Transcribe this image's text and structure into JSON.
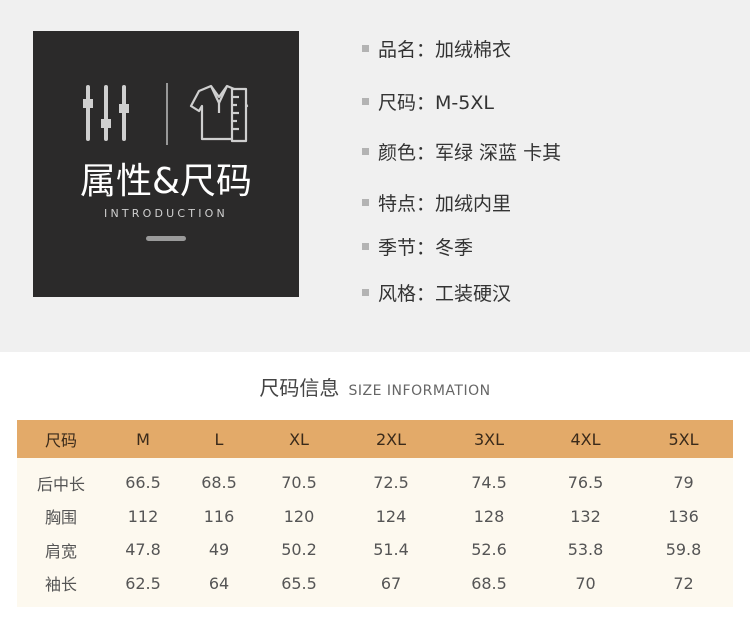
{
  "badge": {
    "title": "属性&尺码",
    "subtitle": "INTRODUCTION",
    "sliders_icon": "sliders-icon",
    "shirt_icon": "shirt-ruler-icon"
  },
  "attributes": [
    {
      "text": "品名：加绒棉衣"
    },
    {
      "text": "尺码：M-5XL"
    },
    {
      "text": "颜色：军绿 深蓝 卡其"
    },
    {
      "text": "特点：加绒内里"
    },
    {
      "text": "季节：冬季"
    },
    {
      "text": "风格：工装硬汉"
    }
  ],
  "size_section": {
    "title_zh": "尺码信息",
    "title_en": "SIZE INFORMATION"
  },
  "size_table": {
    "headers": [
      "尺码",
      "M",
      "L",
      "XL",
      "2XL",
      "3XL",
      "4XL",
      "5XL"
    ],
    "rows": [
      [
        "后中长",
        "66.5",
        "68.5",
        "70.5",
        "72.5",
        "74.5",
        "76.5",
        "79"
      ],
      [
        "胸围",
        "112",
        "116",
        "120",
        "124",
        "128",
        "132",
        "136"
      ],
      [
        "肩宽",
        "47.8",
        "49",
        "50.2",
        "51.4",
        "52.6",
        "53.8",
        "59.8"
      ],
      [
        "袖长",
        "62.5",
        "64",
        "65.5",
        "67",
        "68.5",
        "70",
        "72"
      ]
    ]
  },
  "colors": {
    "panel": "#2b2a2a",
    "header_row": "#e3aa69",
    "table_body": "#fdf9ef",
    "top_bg": "#f0f0f0"
  }
}
